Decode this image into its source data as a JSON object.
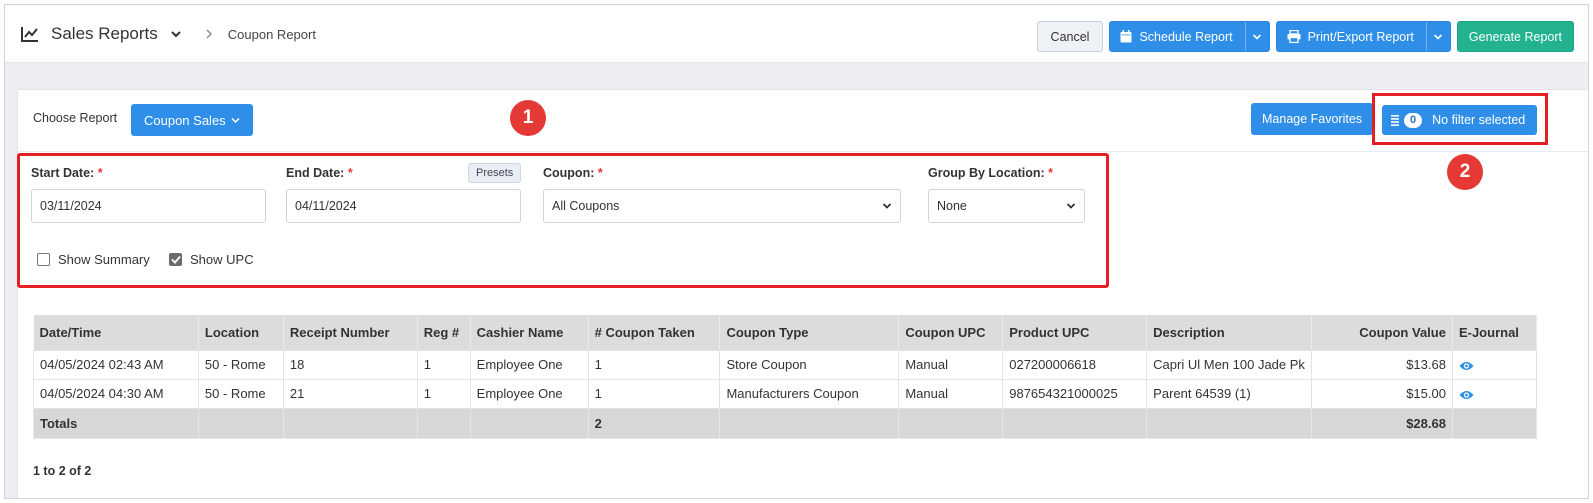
{
  "header": {
    "title": "Sales Reports",
    "breadcrumb": "Coupon Report",
    "cancel": "Cancel",
    "schedule": "Schedule Report",
    "print_export": "Print/Export Report",
    "generate": "Generate Report"
  },
  "toolbar": {
    "choose_label": "Choose Report",
    "report_selected": "Coupon Sales",
    "manage_favorites": "Manage Favorites",
    "filter_count": "0",
    "filter_label": "No filter selected"
  },
  "annotations": {
    "one": "1",
    "two": "2"
  },
  "filters": {
    "start_label": "Start Date:",
    "start_value": "03/11/2024",
    "end_label": "End Date:",
    "end_value": "04/11/2024",
    "presets": "Presets",
    "coupon_label": "Coupon:",
    "coupon_value": "All Coupons",
    "group_label": "Group By Location:",
    "group_value": "None",
    "required_mark": "*",
    "show_summary": "Show Summary",
    "show_upc": "Show UPC",
    "show_summary_checked": false,
    "show_upc_checked": true
  },
  "table": {
    "columns": [
      "Date/Time",
      "Location",
      "Receipt Number",
      "Reg #",
      "Cashier Name",
      "# Coupon Taken",
      "Coupon Type",
      "Coupon UPC",
      "Product UPC",
      "Description",
      "Coupon Value",
      "E-Journal"
    ],
    "rows": [
      [
        "04/05/2024 02:43 AM",
        "50 - Rome",
        "18",
        "1",
        "Employee One",
        "1",
        "Store Coupon",
        "Manual",
        "027200006618",
        "Capri Ul Men 100 Jade Pk",
        "$13.68"
      ],
      [
        "04/05/2024 04:30 AM",
        "50 - Rome",
        "21",
        "1",
        "Employee One",
        "1",
        "Manufacturers Coupon",
        "Manual",
        "987654321000025",
        "Parent 64539 (1)",
        "$15.00"
      ]
    ],
    "totals": {
      "label": "Totals",
      "coupons": "2",
      "value": "$28.68"
    }
  },
  "pagination": "1 to 2 of 2",
  "colors": {
    "primary": "#2f8fe8",
    "success": "#22b28f",
    "highlight": "#e31e24"
  }
}
